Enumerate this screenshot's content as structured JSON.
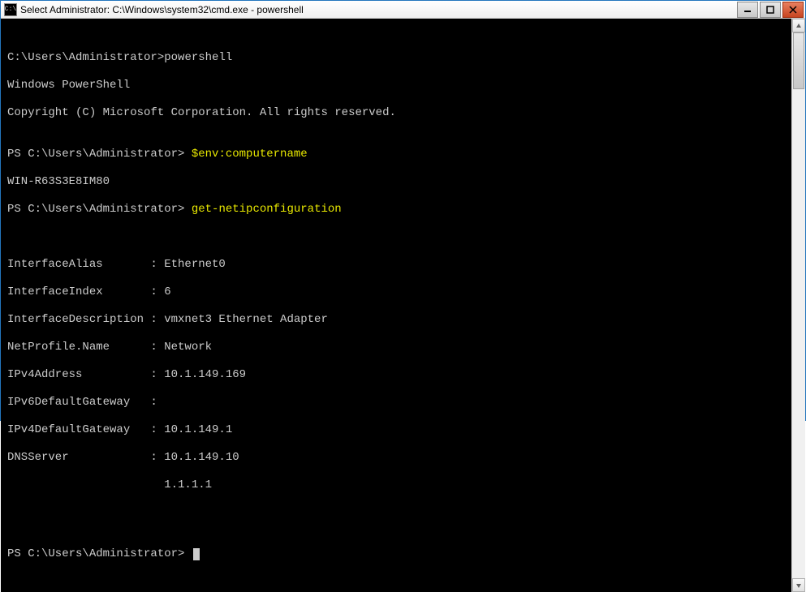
{
  "window": {
    "title": "Select Administrator: C:\\Windows\\system32\\cmd.exe - powershell",
    "icon_text": "C:\\"
  },
  "terminal": {
    "line1_prompt": "C:\\Users\\Administrator>",
    "line1_cmd": "powershell",
    "line2": "Windows PowerShell",
    "line3": "Copyright (C) Microsoft Corporation. All rights reserved.",
    "blank": "",
    "ps_prompt": "PS C:\\Users\\Administrator> ",
    "cmd_envname": "$env:computername",
    "hostname": "WIN-R63S3E8IM80",
    "cmd_netip": "get-netipconfiguration",
    "cfg": {
      "InterfaceAlias": "Ethernet0",
      "InterfaceIndex": "6",
      "InterfaceDescription": "vmxnet3 Ethernet Adapter",
      "NetProfileName": "Network",
      "IPv4Address": "10.1.149.169",
      "IPv6DefaultGateway": "",
      "IPv4DefaultGateway": "10.1.149.1",
      "DNSServer1": "10.1.149.10",
      "DNSServer2": "1.1.1.1"
    },
    "labels": {
      "InterfaceAlias": "InterfaceAlias",
      "InterfaceIndex": "InterfaceIndex",
      "InterfaceDescription": "InterfaceDescription",
      "NetProfileName": "NetProfile.Name",
      "IPv4Address": "IPv4Address",
      "IPv6DefaultGateway": "IPv6DefaultGateway",
      "IPv4DefaultGateway": "IPv4DefaultGateway",
      "DNSServer": "DNSServer"
    },
    "colon": ": "
  }
}
